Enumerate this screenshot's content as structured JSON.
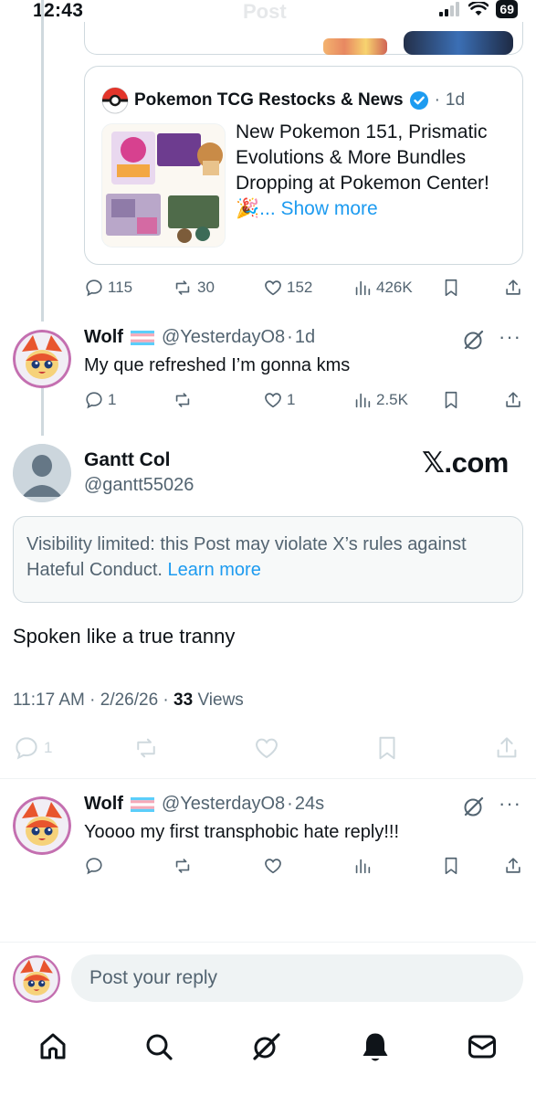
{
  "status_bar": {
    "time": "12:43",
    "ghost_title": "Post",
    "battery": "69"
  },
  "quote": {
    "source_name": "Pokemon TCG Restocks & News",
    "dot": "·",
    "time": "1d",
    "text": "New Pokemon 151, Prismatic Evolutions & More Bundles Dropping at Pokemon Center! 🎉",
    "show_more": "... Show more"
  },
  "parent_actions": {
    "replies": "115",
    "reposts": "30",
    "likes": "152",
    "views": "426K"
  },
  "reply1": {
    "name": "Wolf",
    "handle": "@YesterdayO8",
    "dot": "·",
    "time": "1d",
    "text": "My que refreshed I’m gonna kms",
    "replies": "1",
    "likes": "1",
    "views": "2.5K"
  },
  "focus": {
    "name": "Gantt Col",
    "handle": "@gantt55026",
    "watermark": "𝕏.com",
    "notice": "Visibility limited: this Post may violate X’s rules against Hateful Conduct.",
    "learn_more": "Learn more",
    "text": "Spoken like a true tranny",
    "time": "11:17 AM · 2/26/26 · ",
    "views_count": "33",
    "views_label": "Views",
    "replies": "1"
  },
  "reply2": {
    "name": "Wolf",
    "handle": "@YesterdayO8",
    "dot": "·",
    "time": "24s",
    "text": "Yoooo my first transphobic hate reply!!!"
  },
  "compose": {
    "placeholder": "Post your reply"
  },
  "colors": {
    "accent": "#1d9bf0",
    "muted": "#536471",
    "border": "#cfd9de"
  }
}
